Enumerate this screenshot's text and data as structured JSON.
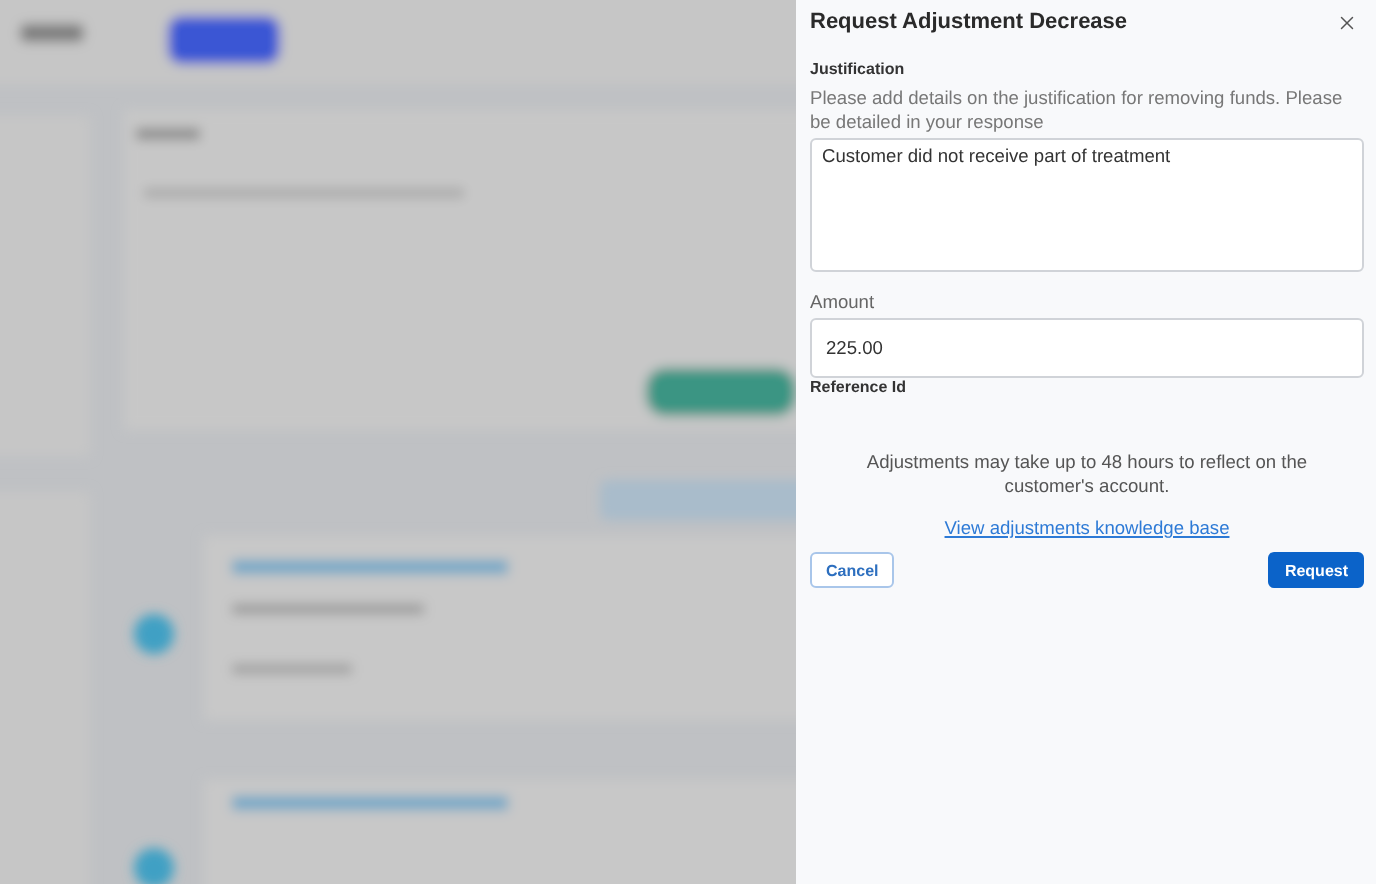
{
  "drawer": {
    "title": "Request Adjustment Decrease",
    "justification": {
      "label": "Justification",
      "hint": "Please add details on the justification for removing funds. Please be detailed in your response",
      "value": "Customer did not receive part of treatment"
    },
    "amount": {
      "label": "Amount",
      "value": "225.00"
    },
    "reference": {
      "label": "Reference Id"
    },
    "notice": "Adjustments may take up to 48 hours to reflect on the customer's account.",
    "link": "View adjustments knowledge base",
    "buttons": [
      {
        "label": "Cancel",
        "kind": "secondary"
      },
      {
        "label": "Request",
        "kind": "primary"
      }
    ]
  }
}
